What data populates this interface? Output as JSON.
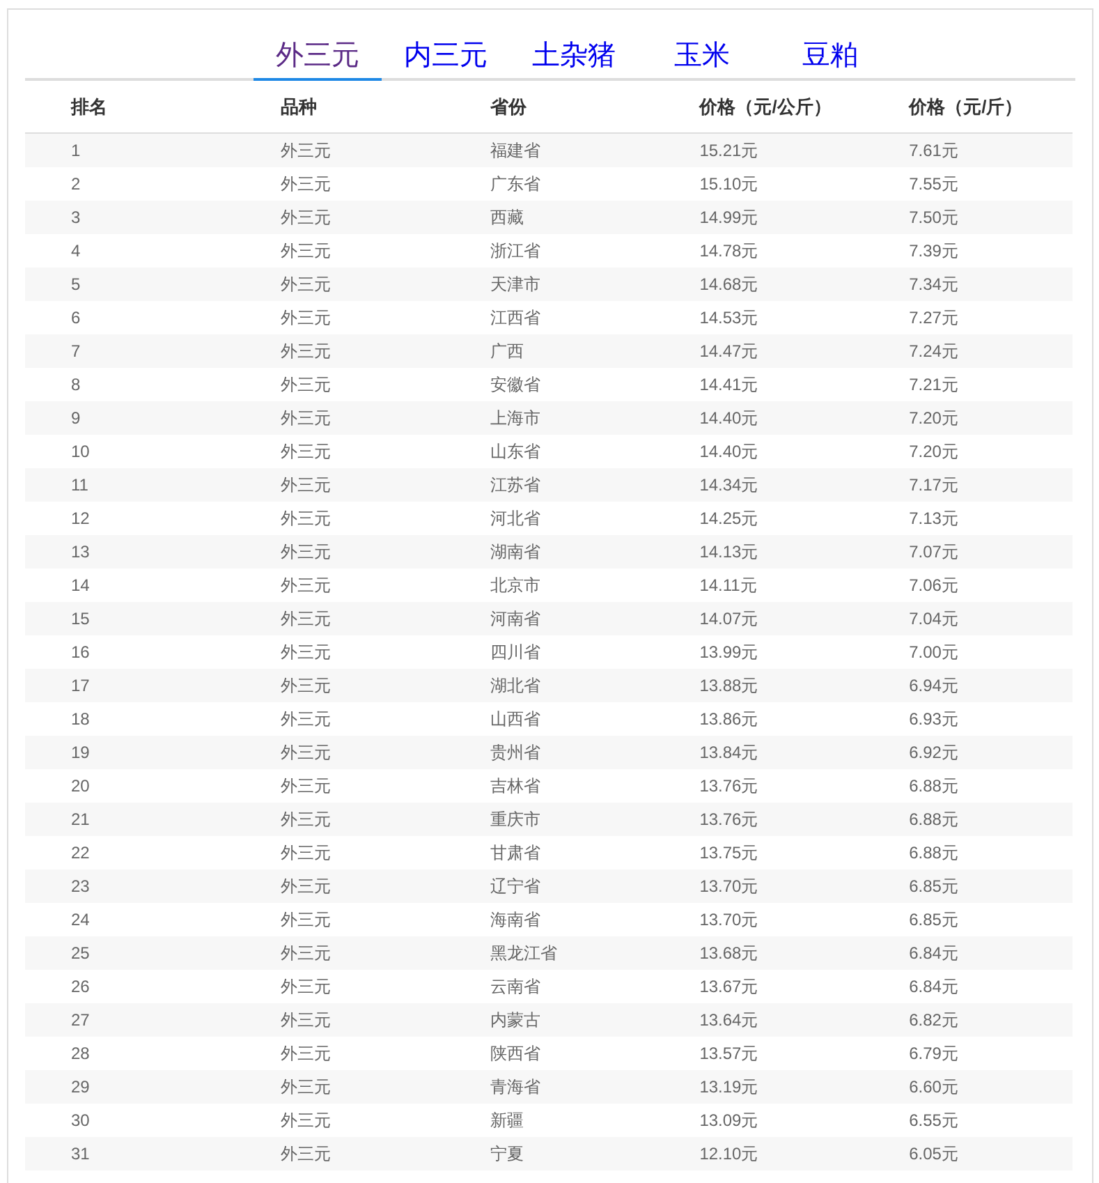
{
  "tabs": [
    {
      "label": "外三元",
      "selected": true
    },
    {
      "label": "内三元",
      "selected": false
    },
    {
      "label": "土杂猪",
      "selected": false
    },
    {
      "label": "玉米",
      "selected": false
    },
    {
      "label": "豆粕",
      "selected": false
    }
  ],
  "table": {
    "columns": [
      "排名",
      "品种",
      "省份",
      "价格（元/公斤）",
      "价格（元/斤）"
    ],
    "rows": [
      [
        "1",
        "外三元",
        "福建省",
        "15.21元",
        "7.61元"
      ],
      [
        "2",
        "外三元",
        "广东省",
        "15.10元",
        "7.55元"
      ],
      [
        "3",
        "外三元",
        "西藏",
        "14.99元",
        "7.50元"
      ],
      [
        "4",
        "外三元",
        "浙江省",
        "14.78元",
        "7.39元"
      ],
      [
        "5",
        "外三元",
        "天津市",
        "14.68元",
        "7.34元"
      ],
      [
        "6",
        "外三元",
        "江西省",
        "14.53元",
        "7.27元"
      ],
      [
        "7",
        "外三元",
        "广西",
        "14.47元",
        "7.24元"
      ],
      [
        "8",
        "外三元",
        "安徽省",
        "14.41元",
        "7.21元"
      ],
      [
        "9",
        "外三元",
        "上海市",
        "14.40元",
        "7.20元"
      ],
      [
        "10",
        "外三元",
        "山东省",
        "14.40元",
        "7.20元"
      ],
      [
        "11",
        "外三元",
        "江苏省",
        "14.34元",
        "7.17元"
      ],
      [
        "12",
        "外三元",
        "河北省",
        "14.25元",
        "7.13元"
      ],
      [
        "13",
        "外三元",
        "湖南省",
        "14.13元",
        "7.07元"
      ],
      [
        "14",
        "外三元",
        "北京市",
        "14.11元",
        "7.06元"
      ],
      [
        "15",
        "外三元",
        "河南省",
        "14.07元",
        "7.04元"
      ],
      [
        "16",
        "外三元",
        "四川省",
        "13.99元",
        "7.00元"
      ],
      [
        "17",
        "外三元",
        "湖北省",
        "13.88元",
        "6.94元"
      ],
      [
        "18",
        "外三元",
        "山西省",
        "13.86元",
        "6.93元"
      ],
      [
        "19",
        "外三元",
        "贵州省",
        "13.84元",
        "6.92元"
      ],
      [
        "20",
        "外三元",
        "吉林省",
        "13.76元",
        "6.88元"
      ],
      [
        "21",
        "外三元",
        "重庆市",
        "13.76元",
        "6.88元"
      ],
      [
        "22",
        "外三元",
        "甘肃省",
        "13.75元",
        "6.88元"
      ],
      [
        "23",
        "外三元",
        "辽宁省",
        "13.70元",
        "6.85元"
      ],
      [
        "24",
        "外三元",
        "海南省",
        "13.70元",
        "6.85元"
      ],
      [
        "25",
        "外三元",
        "黑龙江省",
        "13.68元",
        "6.84元"
      ],
      [
        "26",
        "外三元",
        "云南省",
        "13.67元",
        "6.84元"
      ],
      [
        "27",
        "外三元",
        "内蒙古",
        "13.64元",
        "6.82元"
      ],
      [
        "28",
        "外三元",
        "陕西省",
        "13.57元",
        "6.79元"
      ],
      [
        "29",
        "外三元",
        "青海省",
        "13.19元",
        "6.60元"
      ],
      [
        "30",
        "外三元",
        "新疆",
        "13.09元",
        "6.55元"
      ],
      [
        "31",
        "外三元",
        "宁夏",
        "12.10元",
        "6.05元"
      ]
    ]
  }
}
